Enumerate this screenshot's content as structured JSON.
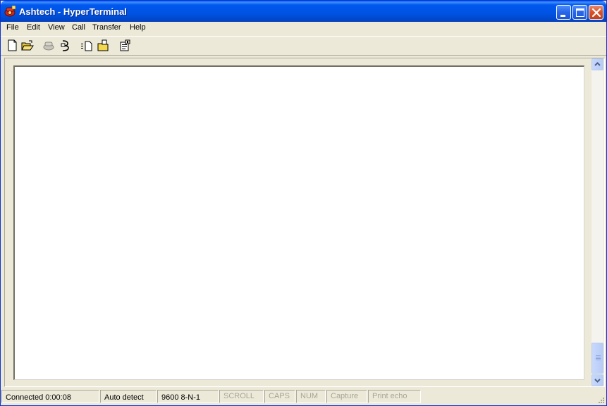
{
  "window": {
    "title": "Ashtech - HyperTerminal",
    "icons": {
      "app": "hyperterminal-phone-icon",
      "minimize": "minimize-icon",
      "maximize": "maximize-icon",
      "close": "close-icon"
    }
  },
  "menu": {
    "items": [
      "File",
      "Edit",
      "View",
      "Call",
      "Transfer",
      "Help"
    ]
  },
  "toolbar": {
    "buttons": [
      "new-document-icon",
      "open-folder-icon",
      "disconnect-icon",
      "dial-icon",
      "send-file-icon",
      "receive-file-icon",
      "properties-icon"
    ]
  },
  "statusbar": {
    "connected": "Connected 0:00:08",
    "detect": "Auto detect",
    "port": "9600 8-N-1",
    "scroll": "SCROLL",
    "caps": "CAPS",
    "num": "NUM",
    "capture": "Capture",
    "print_echo": "Print echo"
  },
  "colors": {
    "titlebar": "#0054e3",
    "face": "#ece9d8",
    "close_button": "#d8502a",
    "dim_text": "#a7a697"
  }
}
